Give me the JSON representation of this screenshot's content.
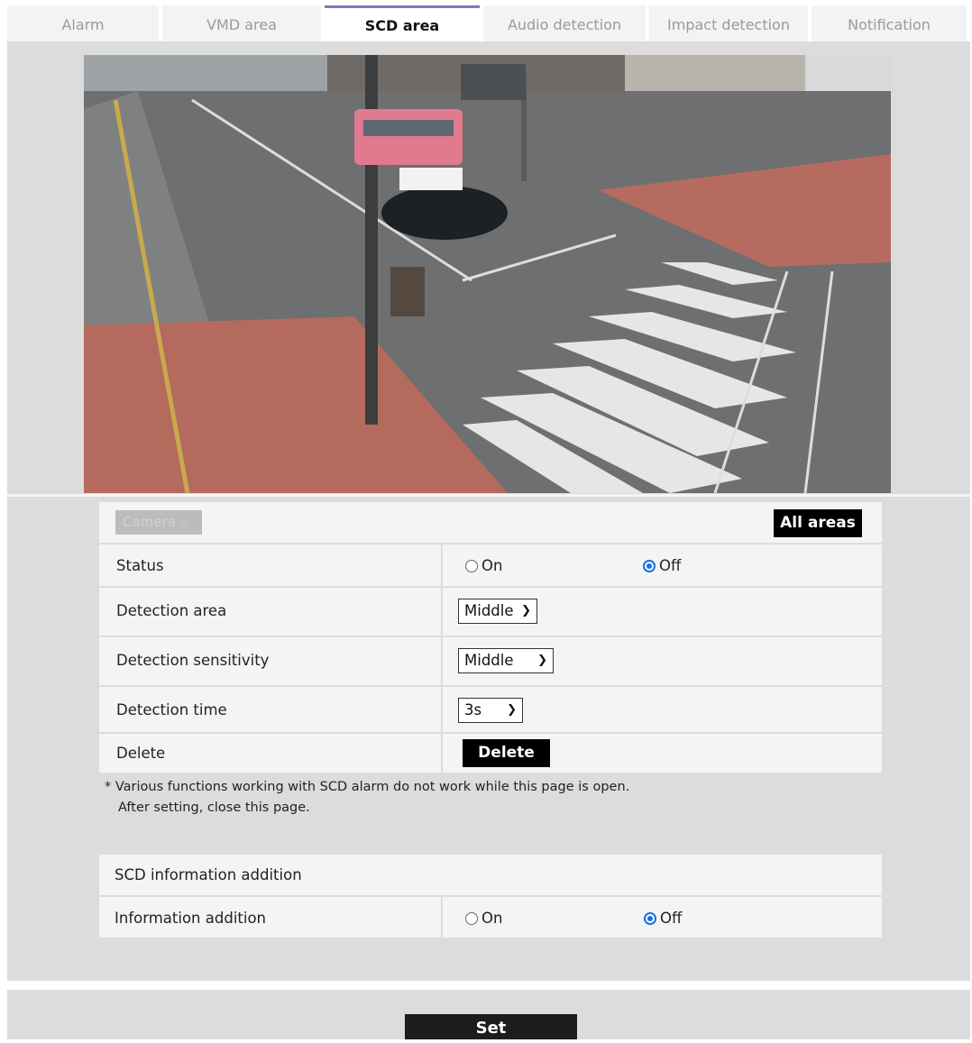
{
  "tabs": [
    {
      "label": "Alarm",
      "active": false
    },
    {
      "label": "VMD area",
      "active": false
    },
    {
      "label": "SCD area",
      "active": true
    },
    {
      "label": "Audio detection",
      "active": false
    },
    {
      "label": "Impact detection",
      "active": false
    },
    {
      "label": "Notification",
      "active": false
    }
  ],
  "camera_select": {
    "value": "Camera"
  },
  "all_areas_label": "All areas",
  "rows": {
    "status": {
      "label": "Status",
      "on_label": "On",
      "off_label": "Off",
      "selected": "Off"
    },
    "detection_area": {
      "label": "Detection area",
      "value": "Middle"
    },
    "detection_sensitivity": {
      "label": "Detection sensitivity",
      "value": "Middle"
    },
    "detection_time": {
      "label": "Detection time",
      "value": "3s"
    },
    "delete": {
      "label": "Delete",
      "button": "Delete"
    }
  },
  "note": {
    "line1": "* Various functions working with SCD alarm do not work while this page is open.",
    "line2": "After setting, close this page."
  },
  "scd_info": {
    "header": "SCD information addition",
    "label": "Information addition",
    "on_label": "On",
    "off_label": "Off",
    "selected": "Off"
  },
  "set_label": "Set",
  "colors": {
    "accent": "#7b78c8",
    "radio": "#1a6fe0",
    "panel": "#dcdcdc"
  }
}
